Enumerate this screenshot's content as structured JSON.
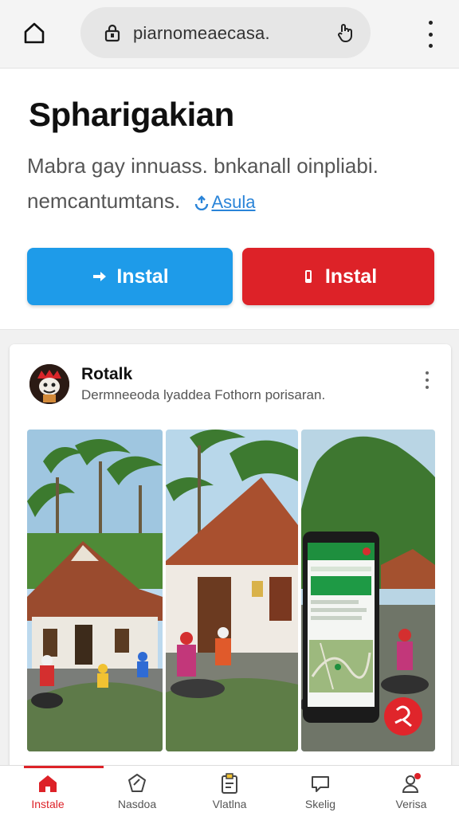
{
  "browser": {
    "url": "piarnomeaecasa.",
    "icons": {
      "home": "home-icon",
      "lock": "lock-icon",
      "share": "share-icon",
      "menu": "more-vert-icon"
    }
  },
  "hero": {
    "title": "Spharigakian",
    "description": "Mabra gay  innuass. bnkanall oinpliabi. nemcantumtans.",
    "link_label": "Asula",
    "install_primary_label": "Instal",
    "install_secondary_label": "Instal",
    "colors": {
      "primary": "#1e9be9",
      "secondary": "#dd2228"
    }
  },
  "card": {
    "name": "Rotalk",
    "subtitle": "Dermneeoda lyaddea Fothorn porisaran.",
    "images": [
      "village-house-palms-photo",
      "house-scooters-photo",
      "phone-map-app-photo"
    ]
  },
  "nav": {
    "items": [
      {
        "label": "Instale",
        "icon": "home-icon",
        "active": true
      },
      {
        "label": "Nasdoa",
        "icon": "tag-icon",
        "active": false
      },
      {
        "label": "Vlatlna",
        "icon": "clipboard-icon",
        "active": false
      },
      {
        "label": "Skelig",
        "icon": "chat-icon",
        "active": false
      },
      {
        "label": "Verisa",
        "icon": "profile-icon",
        "active": false
      }
    ]
  }
}
